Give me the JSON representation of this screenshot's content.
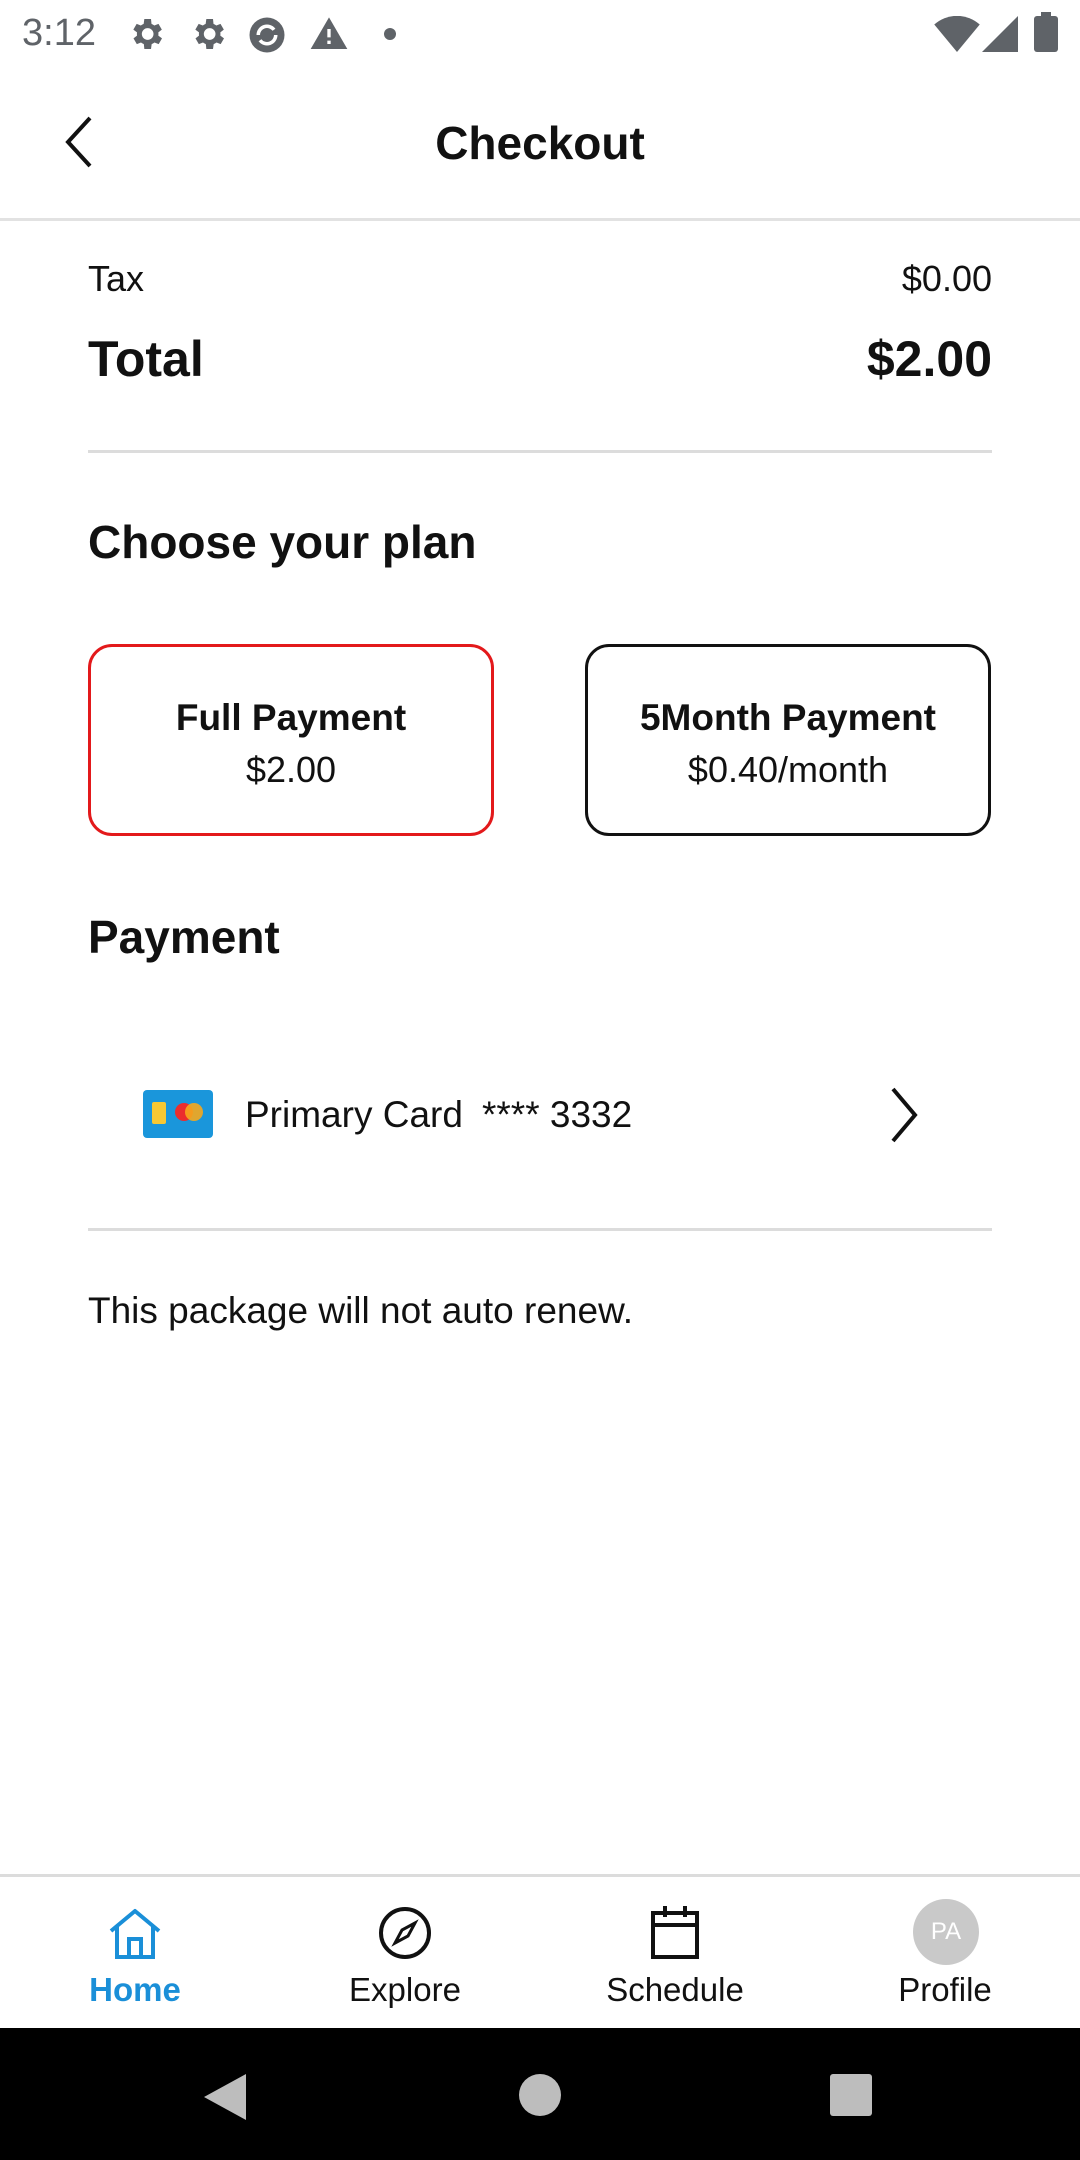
{
  "status_bar": {
    "time": "3:12",
    "icons": [
      "gear-icon",
      "gear-icon",
      "sync-icon",
      "warning-icon",
      "dot-icon",
      "wifi-icon",
      "signal-icon",
      "battery-icon"
    ]
  },
  "header": {
    "title": "Checkout",
    "back_icon": "chevron-left-icon"
  },
  "summary": {
    "tax_label": "Tax",
    "tax_value": "$0.00",
    "total_label": "Total",
    "total_value": "$2.00"
  },
  "plan_section": {
    "title": "Choose your plan",
    "plans": [
      {
        "name": "Full Payment",
        "price": "$2.00",
        "selected": true
      },
      {
        "name": "5Month Payment",
        "price": "$0.40/month",
        "selected": false
      }
    ],
    "selected_border_color": "#e3191b"
  },
  "payment_section": {
    "title": "Payment",
    "card_label": "Primary Card",
    "card_number": "**** 3332",
    "card_icon": "credit-card-icon"
  },
  "note": "This package will not auto renew.",
  "bottom_nav": {
    "items": [
      {
        "label": "Home",
        "icon": "home-icon",
        "active": true
      },
      {
        "label": "Explore",
        "icon": "compass-icon",
        "active": false
      },
      {
        "label": "Schedule",
        "icon": "calendar-icon",
        "active": false
      },
      {
        "label": "Profile",
        "icon": "avatar",
        "active": false
      }
    ],
    "avatar_initials": "PA",
    "active_color": "#1a8fd8"
  },
  "system_nav": {
    "icons": [
      "back-triangle-icon",
      "home-circle-icon",
      "recents-square-icon"
    ]
  }
}
